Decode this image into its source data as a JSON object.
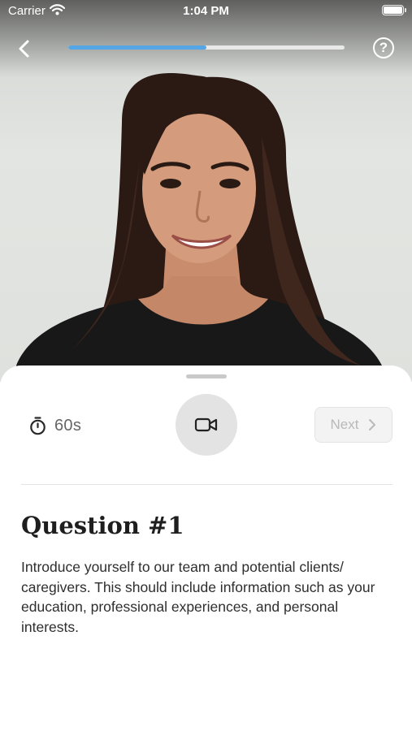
{
  "status_bar": {
    "carrier": "Carrier",
    "time": "1:04 PM"
  },
  "nav": {
    "back_icon": "chevron-left-icon",
    "help_label": "?",
    "progress": 0.5,
    "progress_color": "#54a6e6"
  },
  "recorder": {
    "timer_icon": "stopwatch-icon",
    "timer_label": "60s",
    "record_icon": "video-camera-icon",
    "next_label": "Next",
    "next_icon": "chevron-right-icon"
  },
  "question": {
    "title": "Question #1",
    "body": "Introduce yourself to our team and potential clients/ caregivers. This should include information such as your education, professional experiences, and personal  interests."
  }
}
